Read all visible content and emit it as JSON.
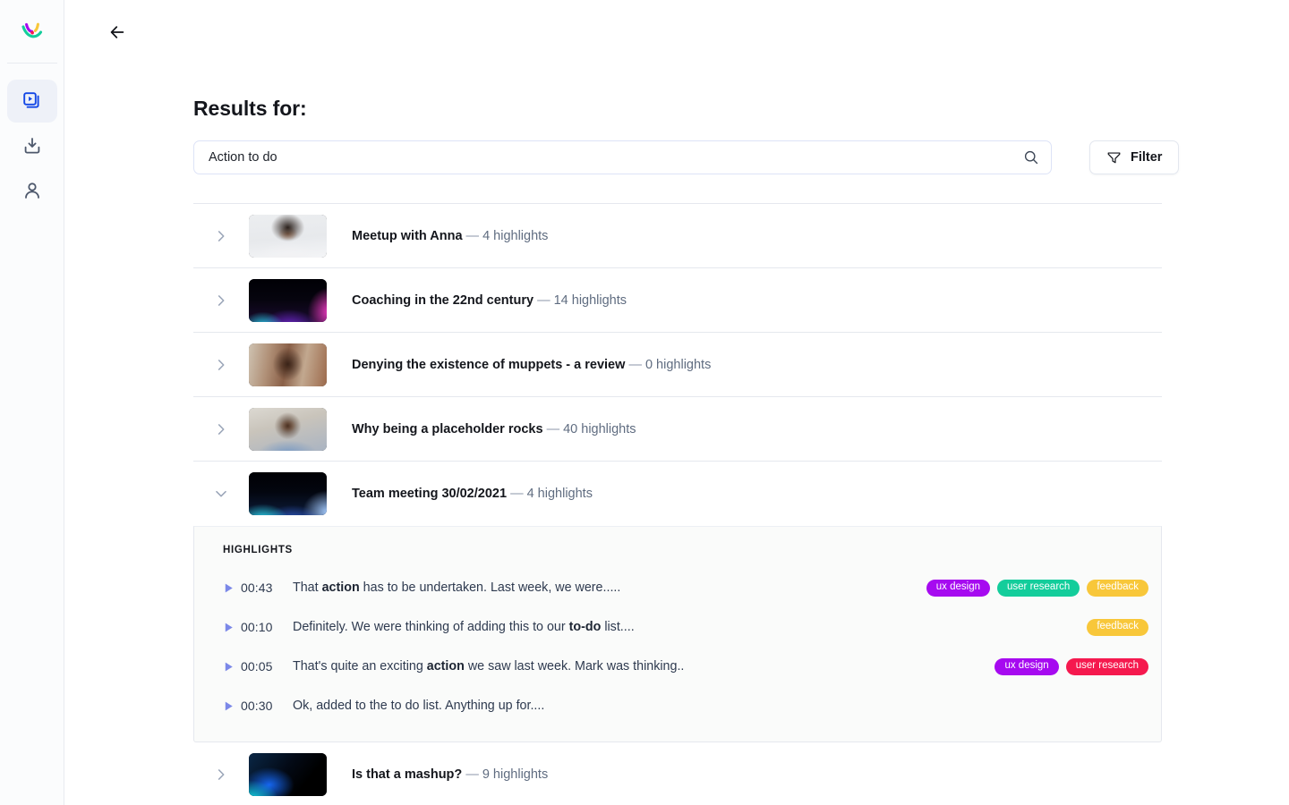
{
  "sidebar": {
    "logo_name": "vowel-logo",
    "items": [
      {
        "icon": "video-library-icon",
        "name": "sidebar-item-library",
        "active": true
      },
      {
        "icon": "download-icon",
        "name": "sidebar-item-downloads",
        "active": false
      },
      {
        "icon": "user-icon",
        "name": "sidebar-item-account",
        "active": false
      }
    ]
  },
  "topbar": {
    "back_icon": "arrow-left-icon"
  },
  "page": {
    "title": "Results for:"
  },
  "search": {
    "value": "Action to do",
    "placeholder": "Search",
    "icon": "search-icon"
  },
  "filter": {
    "label": "Filter",
    "icon": "funnel-icon"
  },
  "results": [
    {
      "title": "Meetup with Anna",
      "separator": "—",
      "highlights_label": "4 highlights",
      "expanded": false,
      "thumb": "g-portrait1"
    },
    {
      "title": "Coaching in the 22nd century",
      "separator": "—",
      "highlights_label": "14 highlights",
      "expanded": false,
      "thumb": "g-neon-purple"
    },
    {
      "title": "Denying the existence of muppets - a review",
      "separator": "—",
      "highlights_label": "0 highlights",
      "expanded": false,
      "thumb": "g-portrait2"
    },
    {
      "title": "Why being a placeholder rocks",
      "separator": "—",
      "highlights_label": "40 highlights",
      "expanded": false,
      "thumb": "g-portrait3"
    },
    {
      "title": "Team meeting 30/02/2021",
      "separator": "—",
      "highlights_label": "4 highlights",
      "expanded": true,
      "thumb": "g-neon-blue"
    },
    {
      "title": "Is that a mashup?",
      "separator": "—",
      "highlights_label": "9 highlights",
      "expanded": false,
      "thumb": "g-neon-diag"
    }
  ],
  "highlights_panel": {
    "section_label": "HIGHLIGHTS",
    "rows": [
      {
        "time": "00:43",
        "text_before": "That ",
        "text_bold": "action",
        "text_after": " has to be undertaken. Last week, we were.....",
        "tags": [
          {
            "label": "ux design",
            "color": "#a60af0"
          },
          {
            "label": "user research",
            "color": "#13cd9b"
          },
          {
            "label": "feedback",
            "color": "#f8c73a"
          }
        ]
      },
      {
        "time": "00:10",
        "text_before": "Definitely. We were thinking of adding this to our ",
        "text_bold": "to-do",
        "text_after": " list....",
        "tags": [
          {
            "label": "feedback",
            "color": "#f8c73a"
          }
        ]
      },
      {
        "time": "00:05",
        "text_before": "That's quite an exciting ",
        "text_bold": "action",
        "text_after": " we saw last week. Mark was thinking..",
        "tags": [
          {
            "label": "ux design",
            "color": "#a60af0"
          },
          {
            "label": "user research",
            "color": "#f5194e"
          }
        ]
      },
      {
        "time": "00:30",
        "text_before": "Ok, added to the to do list. Anything up for....",
        "text_bold": "",
        "text_after": "",
        "tags": []
      }
    ]
  },
  "colors": {
    "accent_blue": "#1347e6",
    "play_icon": "#7b88e8",
    "tag_purple": "#a60af0",
    "tag_teal": "#13cd9b",
    "tag_yellow": "#f8c73a",
    "tag_red": "#f5194e",
    "text_primary": "#14161c",
    "text_muted": "#5f6c80",
    "panel_bg": "#fafbfa",
    "border": "#e5e8ee"
  }
}
